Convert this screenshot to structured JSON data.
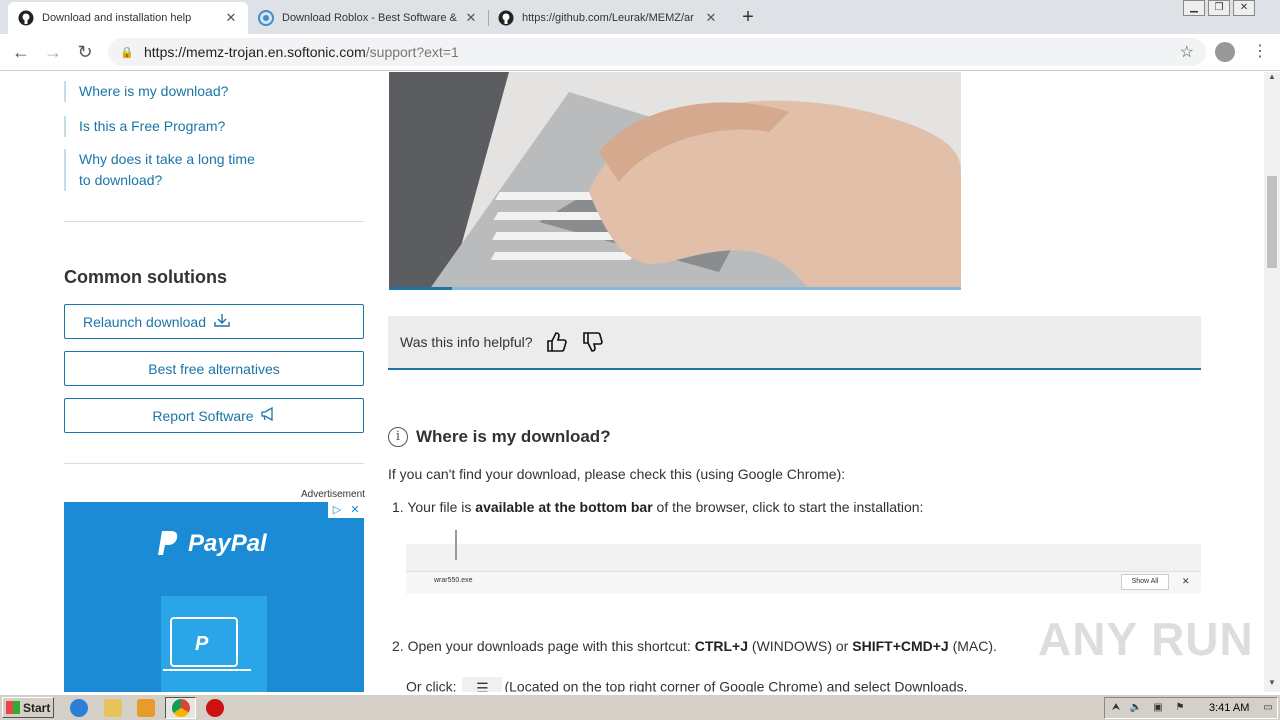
{
  "browser": {
    "tabs": [
      {
        "title": "Download and installation help",
        "active": true,
        "icon": "github-icon"
      },
      {
        "title": "Download Roblox - Best Software &",
        "active": false,
        "icon": "softonic-icon"
      },
      {
        "title": "https://github.com/Leurak/MEMZ/ar",
        "active": false,
        "icon": "github-icon"
      }
    ],
    "url_host": "https://memz-trojan.en.softonic.com",
    "url_path": "/support?ext=1"
  },
  "sidebar": {
    "faq_links": [
      "Where is my download?",
      "Is this a Free Program?",
      "Why does it take a long time to download?"
    ],
    "common_solutions_title": "Common solutions",
    "buttons": {
      "relaunch": "Relaunch download",
      "alternatives": "Best free alternatives",
      "report": "Report Software"
    },
    "ad_label": "Advertisement",
    "ad_brand": "PayPal"
  },
  "main": {
    "feedback_question": "Was this info helpful?",
    "section_title": "Where is my download?",
    "intro": "If you can't find your download, please check this (using Google Chrome):",
    "step1_prefix": "1. Your file is ",
    "step1_bold": "available at the bottom bar",
    "step1_suffix": " of the browser, click to start the installation:",
    "screenshot_filename": "wrar550.exe",
    "screenshot_show_all": "Show All",
    "step2_prefix": "2. Open your downloads page with this shortcut: ",
    "step2_bold1": "CTRL+J",
    "step2_mid": " (WINDOWS) or ",
    "step2_bold2": "SHIFT+CMD+J",
    "step2_suffix": " (MAC).",
    "step2b_prefix": "Or click: ",
    "step2b_suffix": "(Located on the top right corner of Google Chrome) and select Downloads."
  },
  "watermark": "ANY RUN",
  "taskbar": {
    "start_label": "Start",
    "clock": "3:41 AM"
  },
  "colors": {
    "accent": "#1a75a8",
    "ad_background": "#1c8bd6"
  }
}
